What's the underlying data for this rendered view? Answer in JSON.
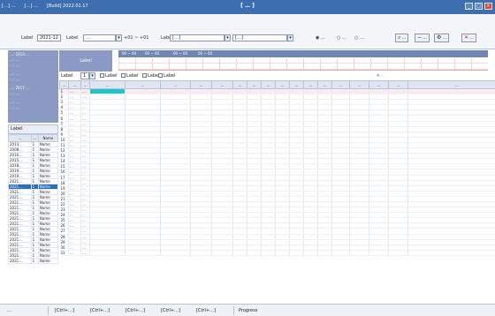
{
  "window": {
    "tabs": [
      "[…]  …",
      "[…] …",
      "[Build] 2022.01.17"
    ],
    "title": "[ … ]",
    "buttons": {
      "minimize": "_",
      "maximize": "□",
      "close": "×"
    }
  },
  "toolbar": {
    "period_label": "Label",
    "period_value": "2021-12",
    "period2_label": "Label",
    "period2_value": "…",
    "range_text": "+01 ~ +01",
    "dept_label": "Label",
    "dept_value": "[…]",
    "group_value": "[…]",
    "radio_options": [
      "…",
      "…",
      "…"
    ],
    "btn_search": "…",
    "btn_delete": "…",
    "btn_batch": "…",
    "btn_close": "…"
  },
  "info": {
    "lines": [
      "…: 2013-…",
      "…: …",
      "…: …",
      "",
      "…: …",
      "…: …",
      "",
      "…: 2017-…",
      "…: …",
      "",
      "…: …",
      "…: …"
    ]
  },
  "emp_list": {
    "title": "Label",
    "headers": [
      "…",
      "…",
      "Name"
    ],
    "rows": [
      [
        "2013…",
        "1",
        "Name"
      ],
      [
        "2008…",
        "1",
        "Name"
      ],
      [
        "2010…",
        "1",
        "Name"
      ],
      [
        "2015…",
        "1",
        "Name"
      ],
      [
        "2018…",
        "1",
        "Name"
      ],
      [
        "2019…",
        "1",
        "Name"
      ],
      [
        "2019…",
        "1",
        "Name"
      ],
      [
        "2021…",
        "1",
        "Name"
      ],
      [
        "2021…",
        "1",
        "Name"
      ],
      [
        "2021…",
        "1",
        "Name"
      ],
      [
        "2021…",
        "1",
        "Name"
      ],
      [
        "2021…",
        "1",
        "Name"
      ],
      [
        "2021…",
        "1",
        "Name"
      ],
      [
        "2021…",
        "1",
        "Name"
      ],
      [
        "2021…",
        "1",
        "Name"
      ],
      [
        "2021…",
        "1",
        "Name"
      ],
      [
        "2021…",
        "1",
        "Name"
      ],
      [
        "2021…",
        "1",
        "Name"
      ],
      [
        "2021…",
        "1",
        "Name"
      ],
      [
        "2021…",
        "1",
        "Name"
      ],
      [
        "2021…",
        "1",
        "Name"
      ],
      [
        "2021…",
        "1",
        "Name"
      ],
      [
        "2021…",
        "1",
        "Name"
      ]
    ],
    "selected_index": 8
  },
  "summary": {
    "label": "Label"
  },
  "timeline": {
    "segments": [
      "00 ~ 00",
      "00 ~ 00",
      "00 ~ 00",
      "00 ~ 00"
    ]
  },
  "filter": {
    "group_label": "Label",
    "group_value": "1",
    "checks": [
      "Label",
      "Label",
      "Label",
      "Label"
    ],
    "notice": "※ …"
  },
  "grid": {
    "headers": [
      "…",
      "…",
      "…",
      "…",
      "…",
      "…",
      "…",
      "…",
      "…",
      "…",
      "…",
      "…",
      "…",
      "…",
      "…",
      "…",
      "…",
      "…",
      "…",
      "…"
    ],
    "rows": [
      [
        "1",
        "…",
        "…"
      ],
      [
        "2",
        "…",
        "…"
      ],
      [
        "3",
        "…",
        "…"
      ],
      [
        "4",
        "…",
        "…"
      ],
      [
        "5",
        "…",
        "…"
      ],
      [
        "6",
        "…",
        "…"
      ],
      [
        "7",
        "…",
        "…"
      ],
      [
        "8",
        "…",
        "…"
      ],
      [
        "9",
        "…",
        "…"
      ],
      [
        "10",
        "…",
        "…"
      ],
      [
        "11",
        "…",
        "…"
      ],
      [
        "12",
        "…",
        "…"
      ],
      [
        "13",
        "…",
        "…"
      ],
      [
        "14",
        "…",
        "…"
      ],
      [
        "15",
        "…",
        "…"
      ],
      [
        "16",
        "…",
        "…"
      ],
      [
        "17",
        "…",
        "…"
      ],
      [
        "18",
        "…",
        "…"
      ],
      [
        "19",
        "…",
        "…"
      ],
      [
        "20",
        "…",
        "…"
      ],
      [
        "21",
        "…",
        "…"
      ],
      [
        "22",
        "…",
        "…"
      ],
      [
        "23",
        "…",
        "…"
      ],
      [
        "24",
        "…",
        "…"
      ],
      [
        "25",
        "…",
        "…"
      ],
      [
        "26",
        "…",
        "…"
      ],
      [
        "27",
        "…",
        "…"
      ],
      [
        "28",
        "…",
        "…"
      ],
      [
        "29",
        "…",
        "…"
      ],
      [
        "30",
        "…",
        "…"
      ],
      [
        "31",
        "…",
        "…"
      ]
    ]
  },
  "statusbar": {
    "mode": "…",
    "items": [
      "[Ctrl+…]",
      "[Ctrl+…]",
      "[Ctrl+…]",
      "[Ctrl+…]",
      "[Ctrl+…]"
    ],
    "progress_label": "Progress"
  },
  "colors": {
    "title": "#3d6fb0",
    "panel": "#8a9ac4",
    "highlight": "#20c6c6",
    "selected": "#2a6fb8",
    "alert": "#d0262a"
  }
}
